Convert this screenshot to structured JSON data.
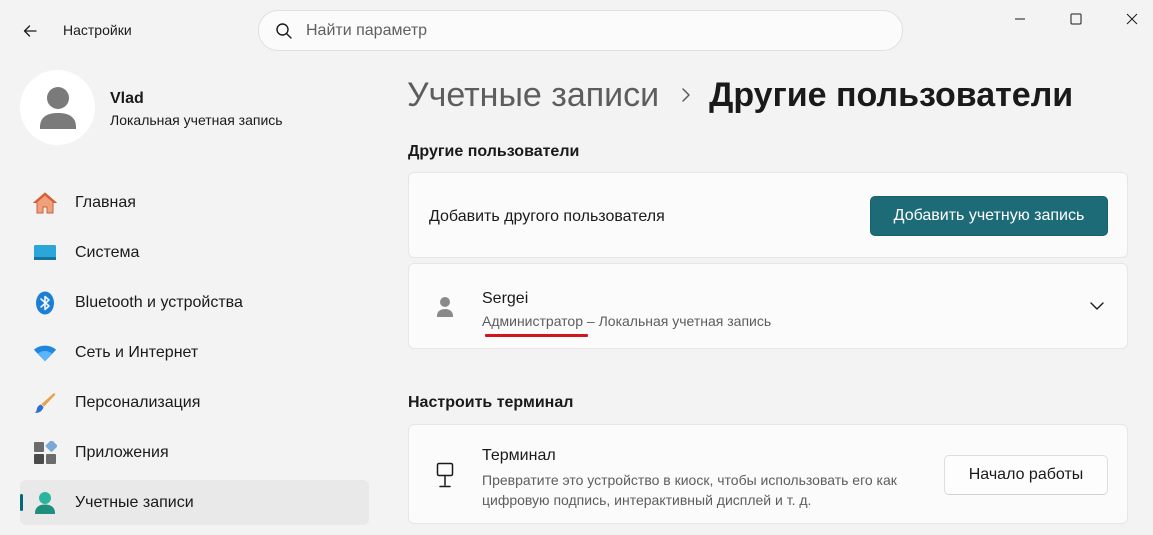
{
  "titlebar": {
    "app_title": "Настройки",
    "back_icon": "arrow-left-icon",
    "controls": [
      "minimize-icon",
      "maximize-icon",
      "close-icon"
    ]
  },
  "search": {
    "placeholder": "Найти параметр",
    "value": "",
    "icon": "search-icon"
  },
  "profile": {
    "name": "Vlad",
    "account_type": "Локальная учетная запись",
    "icon": "person-icon"
  },
  "sidebar": {
    "items": [
      {
        "label": "Главная",
        "icon": "home-icon",
        "active": false
      },
      {
        "label": "Система",
        "icon": "monitor-icon",
        "active": false
      },
      {
        "label": "Bluetooth и устройства",
        "icon": "bluetooth-icon",
        "active": false
      },
      {
        "label": "Сеть и Интернет",
        "icon": "wifi-icon",
        "active": false
      },
      {
        "label": "Персонализация",
        "icon": "brush-icon",
        "active": false
      },
      {
        "label": "Приложения",
        "icon": "apps-icon",
        "active": false
      },
      {
        "label": "Учетные записи",
        "icon": "accounts-icon",
        "active": true
      }
    ]
  },
  "breadcrumb": {
    "parent": "Учетные записи",
    "current": "Другие пользователи"
  },
  "other_users": {
    "section_title": "Другие пользователи",
    "add_label": "Добавить другого пользователя",
    "add_button": "Добавить учетную запись",
    "users": [
      {
        "name": "Sergei",
        "role": "Администратор",
        "separator": " – ",
        "type": "Локальная учетная запись",
        "icon": "person-icon",
        "expand_icon": "chevron-down-icon"
      }
    ]
  },
  "kiosk": {
    "section_title": "Настроить терминал",
    "title": "Терминал",
    "description": "Превратите это устройство в киоск, чтобы использовать его как цифровую подпись, интерактивный дисплей и т. д.",
    "button": "Начало работы",
    "icon": "kiosk-icon"
  },
  "colors": {
    "accent": "#1e6b78",
    "highlight_underline": "#d2141d",
    "background": "#f3f3f3",
    "card": "#fbfbfb"
  }
}
